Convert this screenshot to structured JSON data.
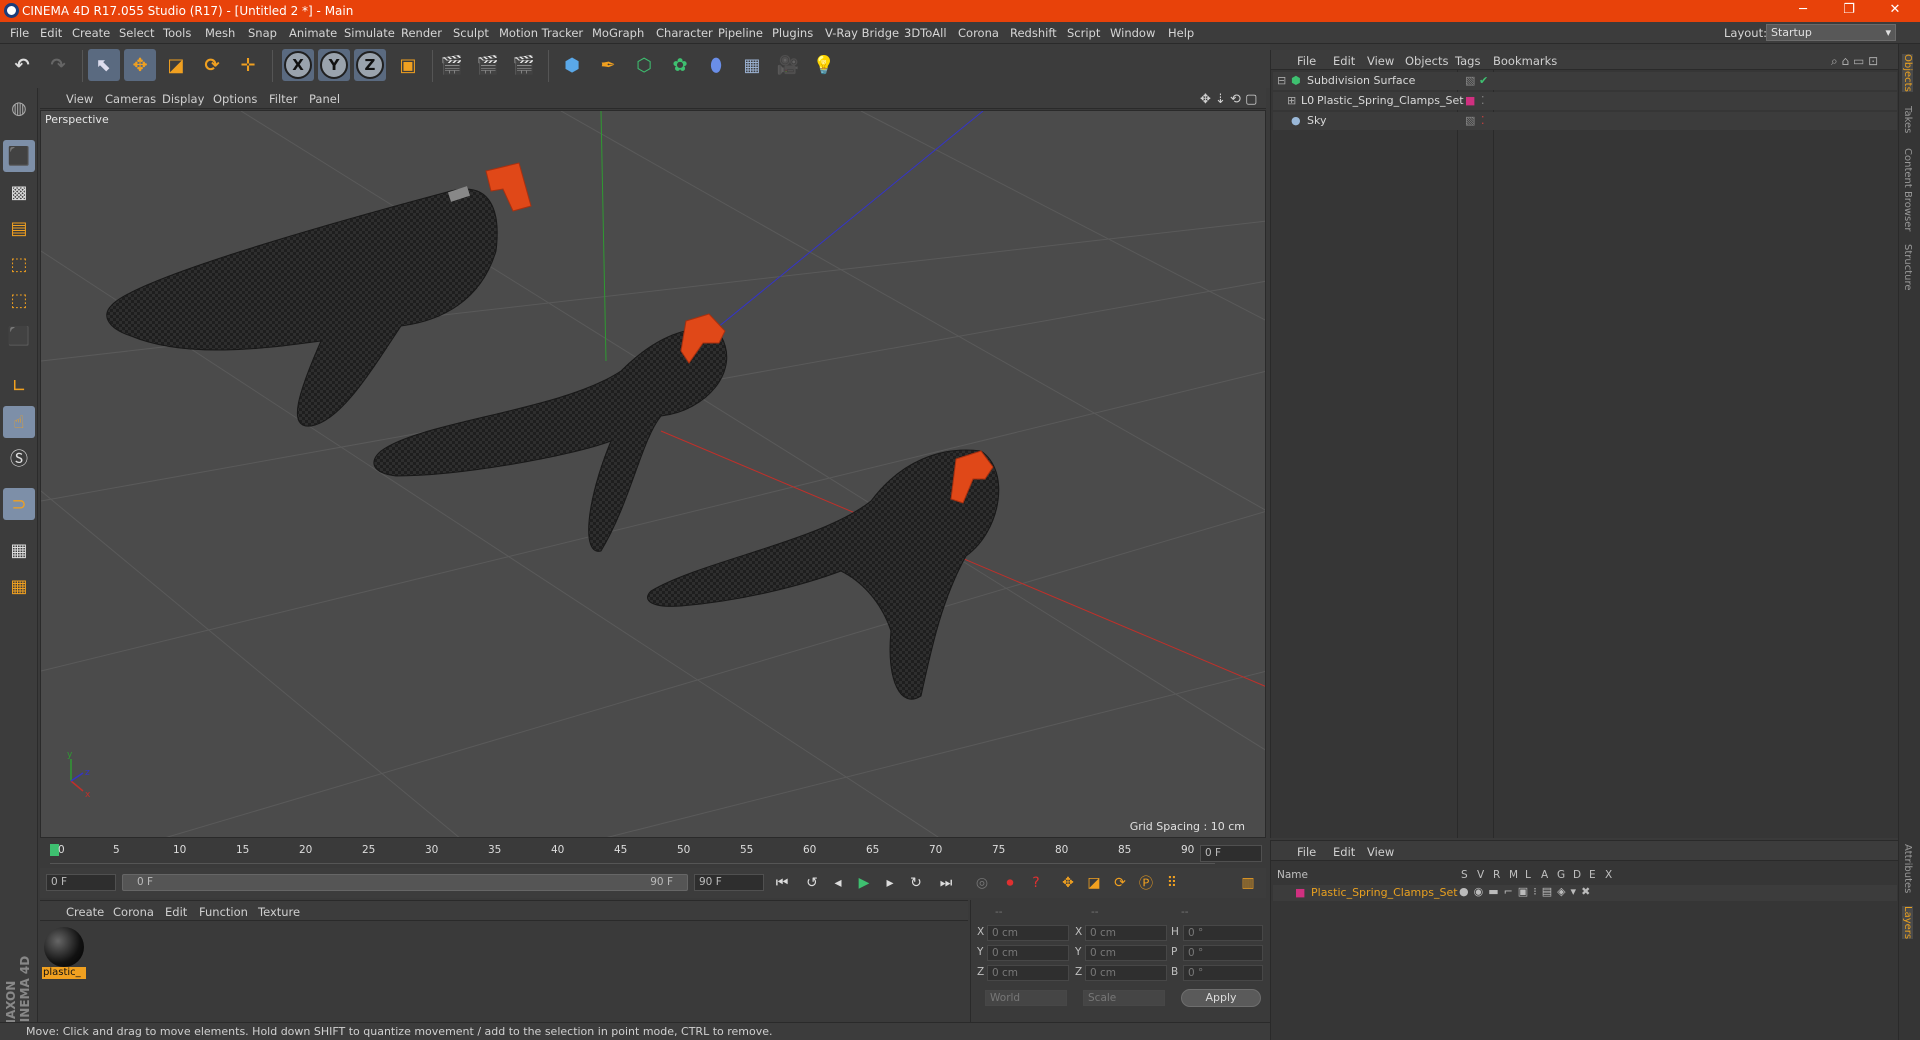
{
  "window": {
    "title": "CINEMA 4D R17.055 Studio (R17) - [Untitled 2 *] - Main",
    "minimize": "─",
    "restore": "❐",
    "close": "✕"
  },
  "menu": [
    "File",
    "Edit",
    "Create",
    "Select",
    "Tools",
    "Mesh",
    "Snap",
    "Animate",
    "Simulate",
    "Render",
    "Sculpt",
    "Motion Tracker",
    "MoGraph",
    "Character",
    "Pipeline",
    "Plugins",
    "V-Ray Bridge",
    "3DToAll",
    "Corona",
    "Redshift",
    "Script",
    "Window",
    "Help"
  ],
  "layout": {
    "label": "Layout:",
    "value": "Startup"
  },
  "toolbar": {
    "x": "X",
    "y": "Y",
    "z": "Z"
  },
  "viewport": {
    "menu": [
      "View",
      "Cameras",
      "Display",
      "Options",
      "Filter",
      "Panel"
    ],
    "label": "Perspective",
    "grid_spacing": "Grid Spacing : 10 cm"
  },
  "timeline": {
    "ticks": [
      "0",
      "5",
      "10",
      "15",
      "20",
      "25",
      "30",
      "35",
      "40",
      "45",
      "50",
      "55",
      "60",
      "65",
      "70",
      "75",
      "80",
      "85",
      "90"
    ],
    "frame_field": "0 F",
    "start": "0 F",
    "range_start": "0 F",
    "range_end": "90 F",
    "end": "90 F"
  },
  "material": {
    "menu": [
      "Create",
      "Corona",
      "Edit",
      "Function",
      "Texture"
    ],
    "name": "plastic_"
  },
  "coords": {
    "headers": [
      "--",
      "--",
      "--"
    ],
    "rows": [
      {
        "a": "X",
        "av": "0 cm",
        "b": "X",
        "bv": "0 cm",
        "c": "H",
        "cv": "0 °"
      },
      {
        "a": "Y",
        "av": "0 cm",
        "b": "Y",
        "bv": "0 cm",
        "c": "P",
        "cv": "0 °"
      },
      {
        "a": "Z",
        "av": "0 cm",
        "b": "Z",
        "bv": "0 cm",
        "c": "B",
        "cv": "0 °"
      }
    ],
    "world": "World",
    "scale": "Scale",
    "apply": "Apply"
  },
  "status": "Move: Click and drag to move elements. Hold down SHIFT to quantize movement / add to the selection in point mode, CTRL to remove.",
  "objects": {
    "menu": [
      "File",
      "Edit",
      "View",
      "Objects",
      "Tags",
      "Bookmarks"
    ],
    "items": [
      "Subdivision Surface",
      "Plastic_Spring_Clamps_Set",
      "Sky"
    ]
  },
  "layers": {
    "menu": [
      "File",
      "Edit",
      "View"
    ],
    "name_header": "Name",
    "cols": [
      "S",
      "V",
      "R",
      "M",
      "L",
      "A",
      "G",
      "D",
      "E",
      "X"
    ],
    "item": "Plastic_Spring_Clamps_Set"
  },
  "right_tabs": [
    "Objects",
    "Takes",
    "Content Browser",
    "Structure",
    "Attributes",
    "Layers"
  ],
  "colors": {
    "accent": "#e8420a",
    "orange": "#e8a020",
    "axis_x": "#c0302a",
    "axis_y": "#2f9a32",
    "axis_z": "#3434c8"
  }
}
